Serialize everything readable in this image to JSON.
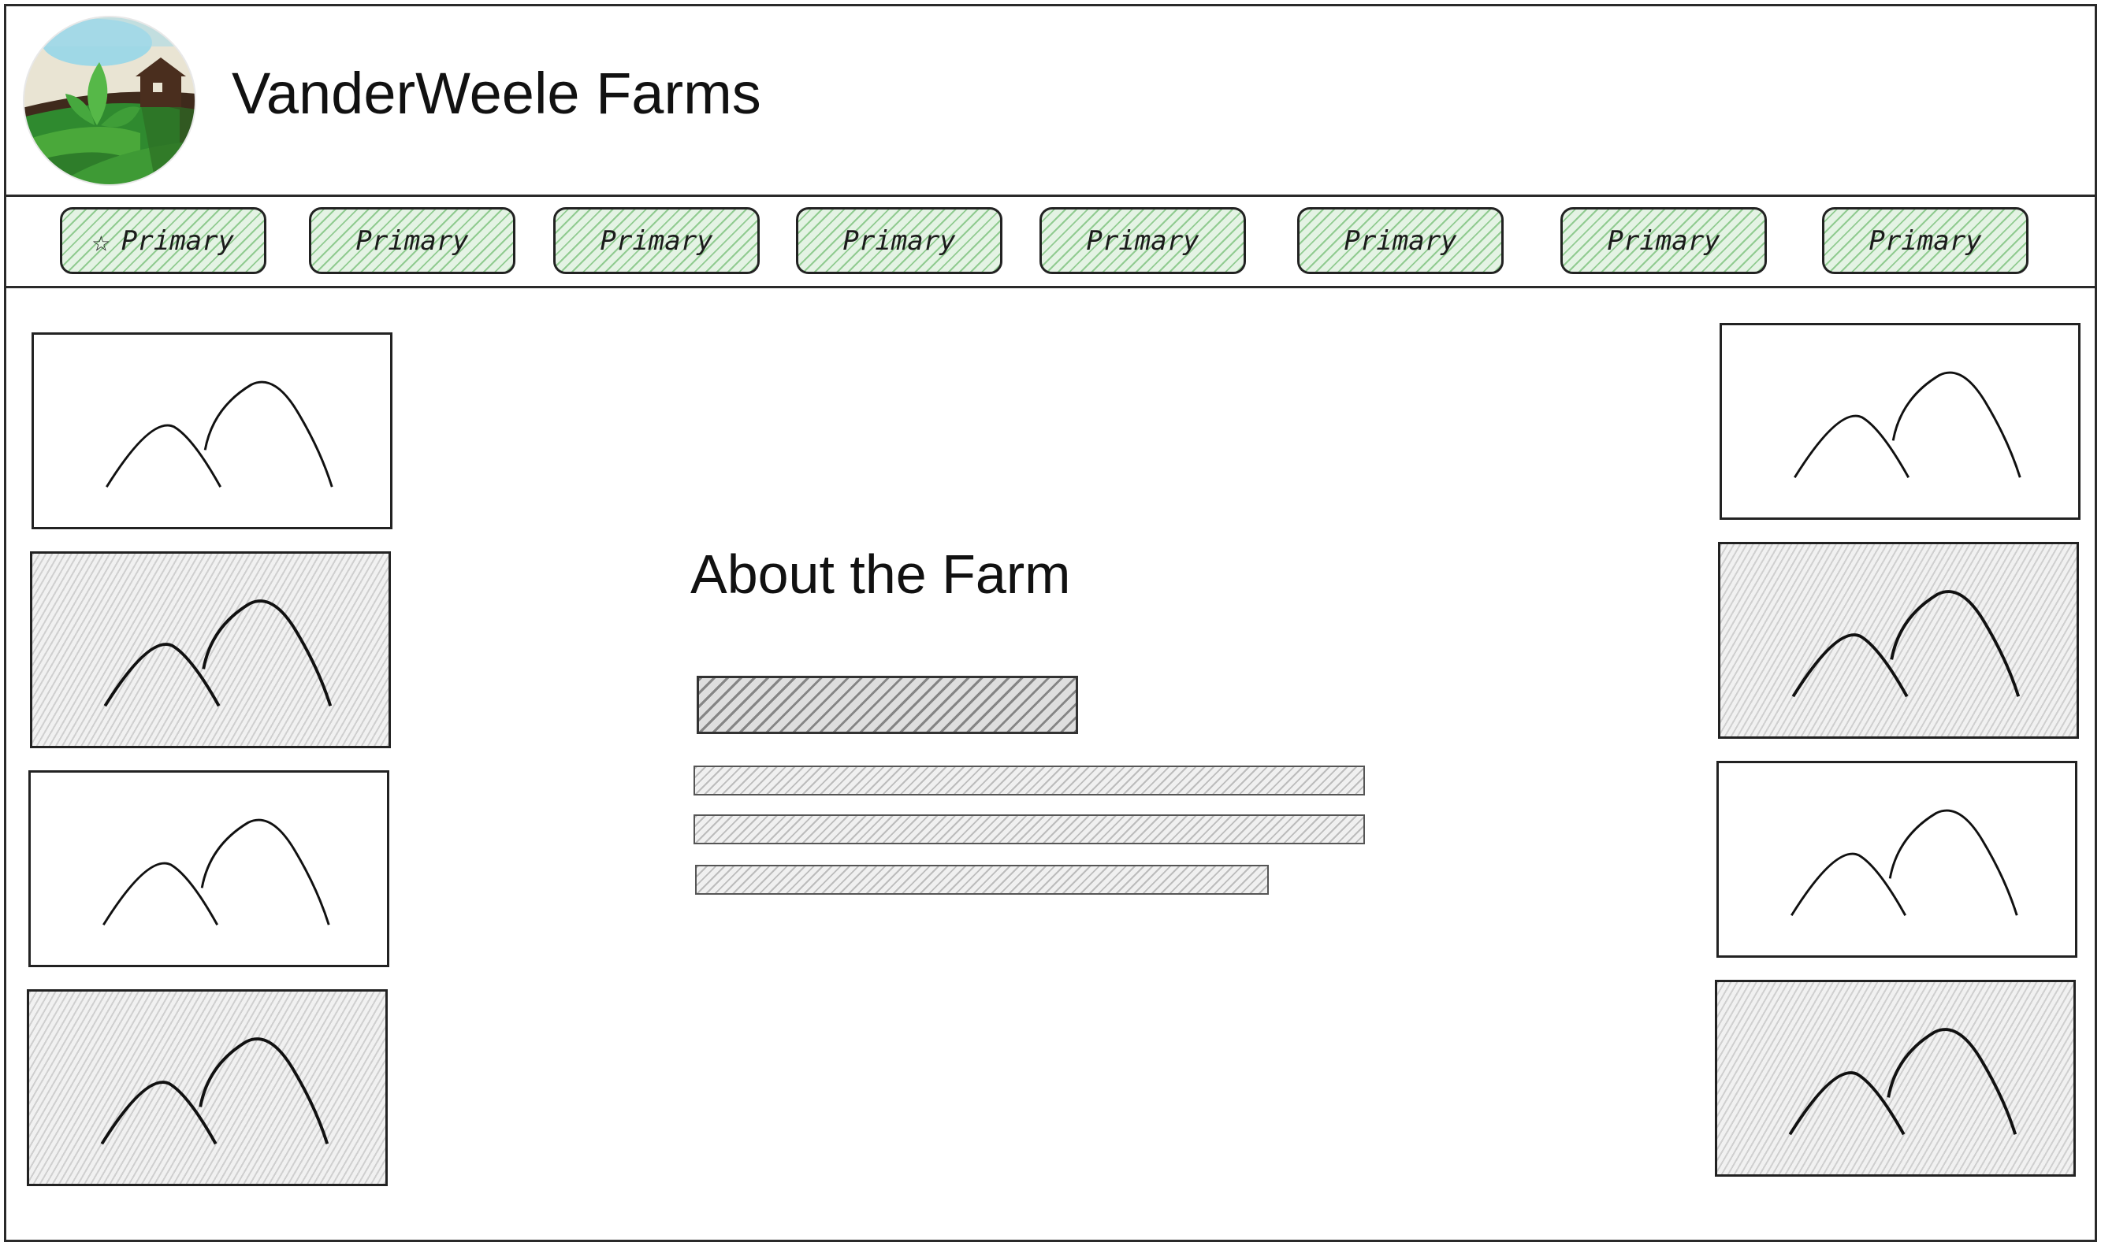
{
  "header": {
    "site_title": "VanderWeele Farms",
    "logo_icon": "farm-logo-icon"
  },
  "nav": {
    "items": [
      {
        "label": "Primary",
        "icon": "star-icon"
      },
      {
        "label": "Primary"
      },
      {
        "label": "Primary"
      },
      {
        "label": "Primary"
      },
      {
        "label": "Primary"
      },
      {
        "label": "Primary"
      },
      {
        "label": "Primary"
      },
      {
        "label": "Primary"
      }
    ]
  },
  "main": {
    "about_title": "About the Farm"
  },
  "colors": {
    "nav_fill": "#e4f3e4",
    "nav_hatch": "#4caa4c",
    "border": "#2a2a2a"
  }
}
